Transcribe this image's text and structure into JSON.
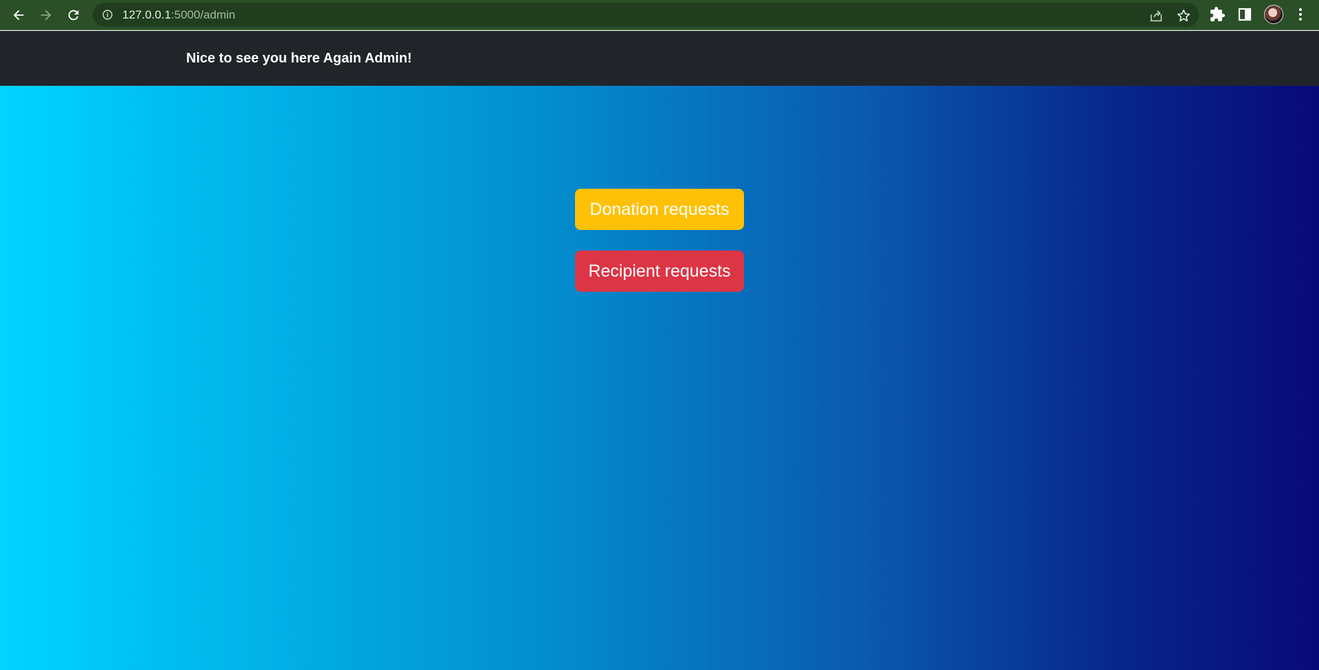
{
  "browser": {
    "url_host": "127.0.0.1",
    "url_path": ":5000/admin",
    "icons": {
      "back": "arrow-left-icon",
      "forward": "arrow-right-icon",
      "reload": "reload-icon",
      "site_info": "info-icon",
      "share": "share-icon",
      "bookmark": "star-icon",
      "extensions": "puzzle-icon",
      "side_panel": "side-panel-icon",
      "menu": "kebab-menu-icon"
    },
    "colors": {
      "toolbar": "#2b4f27",
      "omnibox": "#203d1e"
    }
  },
  "navbar": {
    "greeting": "Nice to see you here Again Admin!",
    "background": "#212529"
  },
  "main": {
    "donation_button_label": "Donation requests",
    "recipient_button_label": "Recipient requests",
    "gradient_start": "#00d4ff",
    "gradient_end": "#090979",
    "donation_button_color": "#ffc107",
    "recipient_button_color": "#dc3545"
  }
}
